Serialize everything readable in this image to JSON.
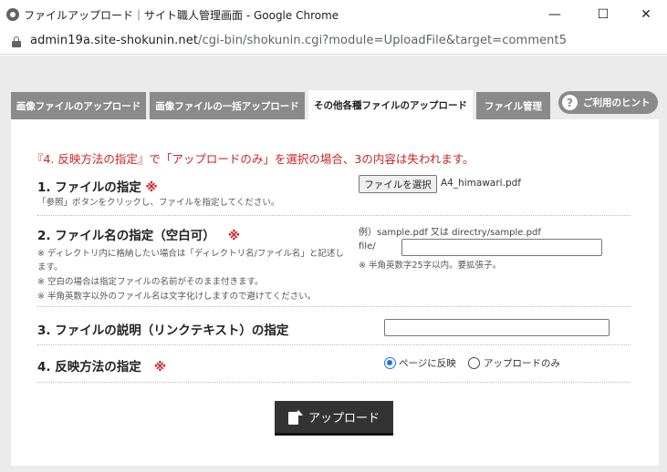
{
  "window": {
    "title": "ファイルアップロード｜サイト職人管理画面 - Google Chrome",
    "minimize": "—",
    "maximize": "☐",
    "close": "✕"
  },
  "address": {
    "host": "admin19a.site-shokunin.net",
    "path": "/cgi-bin/shokunin.cgi?module=UploadFile&target=comment5"
  },
  "tabs": [
    {
      "label": "画像ファイルのアップロード",
      "active": false
    },
    {
      "label": "画像ファイルの一括アップロード",
      "active": false
    },
    {
      "label": "その他各種ファイルのアップロード",
      "active": true
    },
    {
      "label": "ファイル管理",
      "active": false
    }
  ],
  "hint": {
    "icon": "?",
    "label": "ご利用のヒント"
  },
  "warning": "『4. 反映方法の指定』で「アップロードのみ」を選択の場合、3の内容は失われます。",
  "sections": {
    "file": {
      "label": "1. ファイルの指定",
      "required": "※",
      "note": "「参照」ボタンをクリックし、ファイルを指定してください。",
      "button": "ファイルを選択",
      "filename": "A4_himawari.pdf"
    },
    "filename": {
      "label": "2. ファイル名の指定（空白可）",
      "required": "※",
      "notes": [
        "※ ディレクトリ内に格納したい場合は「ディレクトリ名/ファイル名」と記述し",
        "ます。",
        "※ 空白の場合は指定ファイルの名前がそのまま付きます。",
        "※ 半角英数字以外のファイル名は文字化けしますので避けてください。"
      ],
      "example": "例）sample.pdf 又は directry/sample.pdf",
      "prefix": "file/",
      "value": "",
      "side_note": "※ 半角英数字25字以内。要拡張子。"
    },
    "description": {
      "label": "3. ファイルの説明（リンクテキスト）の指定",
      "value": ""
    },
    "method": {
      "label": "4. 反映方法の指定",
      "required": "※",
      "options": [
        {
          "label": "ページに反映",
          "selected": true
        },
        {
          "label": "アップロードのみ",
          "selected": false
        }
      ]
    }
  },
  "upload_button": "アップロード",
  "colors": {
    "accent": "#cc2222",
    "tab": "#8a8a8a",
    "radio": "#1a73e8",
    "button": "#333333"
  }
}
